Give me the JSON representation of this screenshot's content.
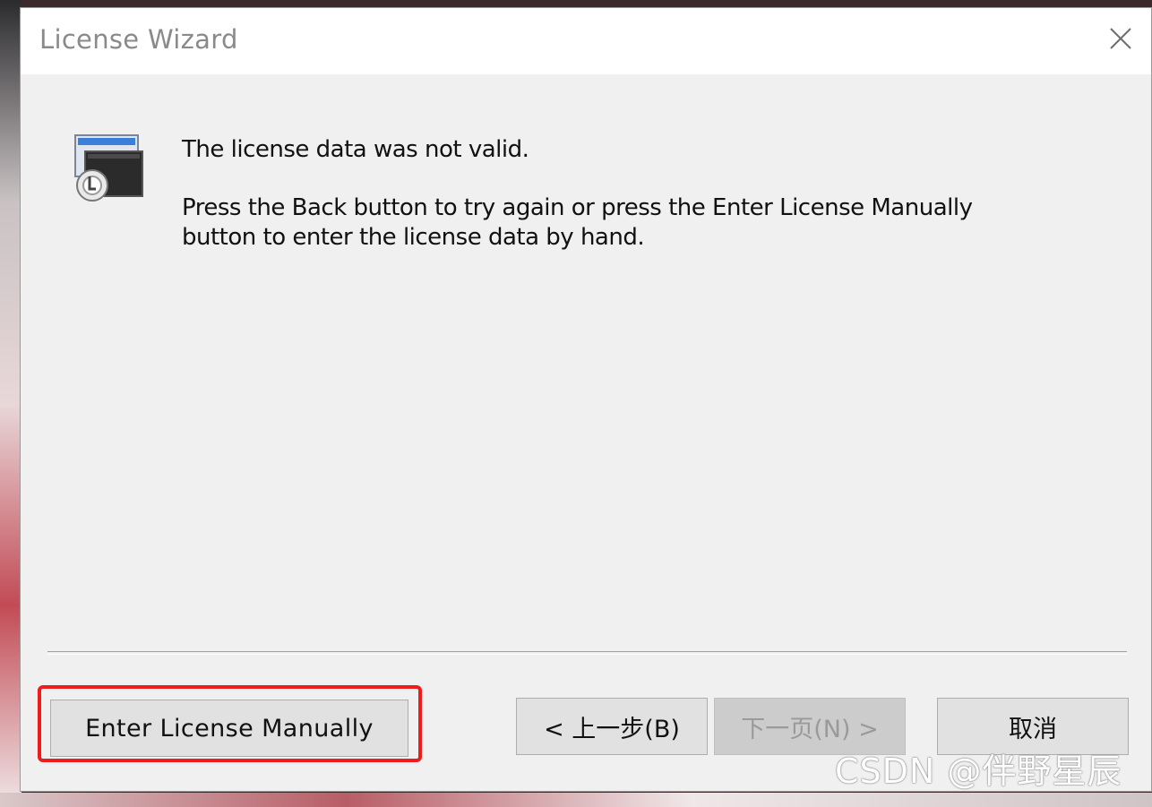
{
  "window": {
    "title": "License Wizard"
  },
  "message": {
    "line1": "The license data was not valid.",
    "line2": "Press the Back button to try again or press the Enter License Manually button to enter the license data by hand."
  },
  "buttons": {
    "enter_manually": "Enter License Manually",
    "back": "< 上一步(B)",
    "next": "下一页(N) >",
    "cancel": "取消"
  },
  "watermark": "CSDN @伴野星辰",
  "icons": {
    "close": "close-icon",
    "wizard": "license-wizard-icon"
  },
  "colors": {
    "highlight": "#ee1c1c",
    "dialog_bg": "#f0f0f0",
    "title_text": "#8a8a8a"
  }
}
